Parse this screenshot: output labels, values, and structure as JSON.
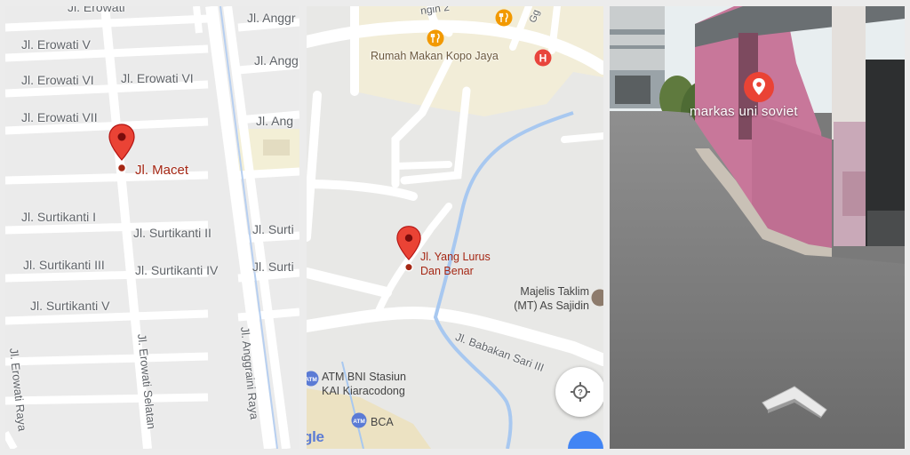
{
  "map_left": {
    "streets": {
      "top_clipped": "Jl. Erowati",
      "anggrek_1": "Jl. Anggr",
      "anggrek_2": "Jl. Angg",
      "anggrek_3": "Jl. Ang",
      "erowati_v": "Jl. Erowati V",
      "erowati_vi_left": "Jl. Erowati VI",
      "erowati_vi_right": "Jl. Erowati VI",
      "erowati_vii": "Jl. Erowati VII",
      "surtikanti_i": "Jl. Surtikanti I",
      "surtikanti_ii": "Jl. Surtikanti II",
      "surti_right": "Jl. Surti",
      "surtikanti_iii": "Jl. Surtikanti III",
      "surtikanti_iv": "Jl. Surtikanti IV",
      "surti_right_2": "Jl. Surti",
      "surtikanti_v": "Jl. Surtikanti V",
      "erowati_selatan": "Jl. Erowati Selatan",
      "anggraini_raya": "Jl. Anggraini Raya",
      "erowati_raya": "Jl. Erowati Raya"
    },
    "pin_label": "Jl. Macet"
  },
  "map_middle": {
    "clipped_top": "ngin 2",
    "clipped_top_right": "Gg",
    "restaurant": "Rumah Makan Kopo Jaya",
    "pin_label_line1": "Jl. Yang Lurus",
    "pin_label_line2": "Dan Benar",
    "majelis_line1": "Majelis Taklim",
    "majelis_line2": "(MT) As Sajidin",
    "babakan": "Jl. Babakan Sari III",
    "atm_line1": "ATM BNI Stasiun",
    "atm_line2": "KAI Kiaracodong",
    "bca": "BCA",
    "google_partial": "gle"
  },
  "street_view": {
    "place_label": "markas uni soviet"
  },
  "colors": {
    "pin_red": "#ea4335",
    "label_red": "#a52714",
    "poi_orange": "#f29900",
    "hotel_red": "#e8453c",
    "atm_blue": "#5b7bd5",
    "water_blue": "#a8c8f0",
    "wall_pink": "#c8779a"
  }
}
